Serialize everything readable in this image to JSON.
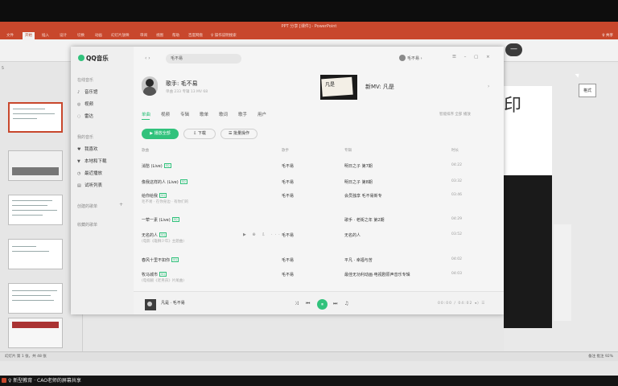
{
  "ppt": {
    "title": "PPT 分享 [课件] - PowerPoint",
    "tabs": [
      "文件",
      "开始",
      "插入",
      "设计",
      "切换",
      "动画",
      "幻灯片放映",
      "审阅",
      "视图",
      "帮助",
      "百度网盘",
      "♀ 操作说明搜索"
    ],
    "active_tab_index": 1,
    "share": "♀ 共享",
    "slide_char": "印",
    "format_btn": "格式",
    "status_left": "幻灯片 第 1 张，共 48 张",
    "status_right": "备注   批注   92%"
  },
  "notify": {
    "text": "♀ 新型教育 · CAO老师的屏幕共享"
  },
  "qq": {
    "logo": "QQ音乐",
    "nav_arrows": "‹  ›",
    "search": "毛不易",
    "user": "毛不易 ›",
    "win_buttons": "☰ – ▢ ×",
    "sidebar": {
      "online_head": "在线音乐",
      "online": [
        {
          "icon": "♪",
          "name": "音乐馆"
        },
        {
          "icon": "◎",
          "name": "视频"
        },
        {
          "icon": "◌",
          "name": "雷达"
        }
      ],
      "mine_head": "我的音乐",
      "mine": [
        {
          "icon": "♥",
          "name": "我喜欢"
        },
        {
          "icon": "▼",
          "name": "本地和下载"
        },
        {
          "icon": "◷",
          "name": "最近播放"
        },
        {
          "icon": "▤",
          "name": "试听列表"
        }
      ],
      "created_head": "创建的歌单",
      "fav_head": "收藏的歌单"
    },
    "artist": {
      "name": "歌手: 毛不易",
      "sub": "单曲 233  专辑 13  MV 68"
    },
    "mv": {
      "thumb_text": "凡是",
      "title": "新MV: 凡是",
      "arrow": "›"
    },
    "tabs": [
      "单曲",
      "视频",
      "专辑",
      "歌单",
      "歌词",
      "歌手",
      "用户"
    ],
    "tabs_right": "智能排序   全部   播放",
    "buttons": {
      "play_all": "▶ 播放全部",
      "download": "⇩ 下载",
      "batch": "☰ 批量操作"
    },
    "columns": {
      "song": "歌曲",
      "singer": "歌手",
      "album": "专辑",
      "duration": "时长"
    },
    "songs": [
      {
        "name": "消愁 (Live)",
        "tag": "SQ",
        "sub": "",
        "singer": "毛不易",
        "album": "明日之子 第7期",
        "dur": "04:22",
        "acts": ""
      },
      {
        "name": "像我这样的人 (Live)",
        "tag": "SQ",
        "sub": "",
        "singer": "毛不易",
        "album": "明日之子 第8期",
        "dur": "03:32",
        "acts": ""
      },
      {
        "name": "给你给我",
        "tag": "SQ",
        "sub": "毛不易 · 在你身边 · 有你们的",
        "singer": "毛不易",
        "album": "会员独享 毛不易新专",
        "dur": "03:46",
        "acts": ""
      },
      {
        "name": "一荤一素 (Live)",
        "tag": "SQ",
        "sub": "",
        "singer": "歌手: 老街之年 第2期",
        "album": "歌手 · 老街之年 第2期",
        "dur": "04:29",
        "acts": ""
      },
      {
        "name": "无名的人",
        "tag": "SQ",
        "sub": "(电影《雄狮少年》主题曲)",
        "singer": "毛不易",
        "album": "无名的人",
        "dur": "03:52",
        "acts": "▶ ⊕ ⇩ ···"
      },
      {
        "name": "春风十里不如你",
        "tag": "SQ",
        "sub": "",
        "singer": "毛不易",
        "album": "平凡 · 幸福与苦",
        "dur": "04:02",
        "acts": ""
      },
      {
        "name": "牧马城市",
        "tag": "SQ",
        "sub": "(电视剧《老男孩》片尾曲)",
        "singer": "毛不易",
        "album": "最佳无功利动画·电视剧原声音乐专辑",
        "dur": "04:03",
        "acts": ""
      }
    ],
    "player": {
      "song": "凡是 · 毛不易",
      "ctrls": [
        "⤨",
        "⏮",
        "⏸",
        "⏭",
        "♫"
      ],
      "right": "00:00 / 04:02  ◂) ☰"
    }
  }
}
